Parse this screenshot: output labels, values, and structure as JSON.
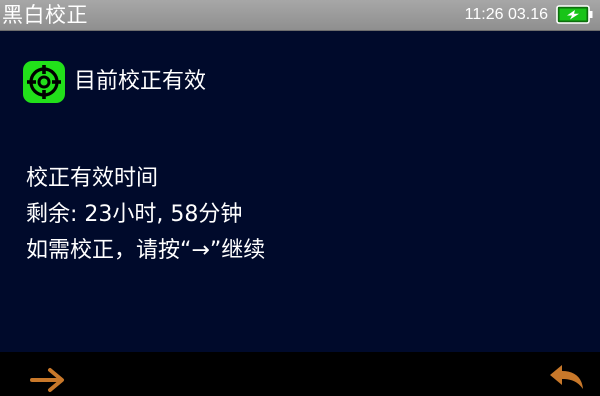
{
  "header": {
    "title": "黑白校正",
    "clock": "11:26 03.16"
  },
  "status": {
    "icon": "crosshair-target-icon",
    "text": "目前校正有效"
  },
  "info": {
    "heading": "校正有效时间",
    "remaining": "剩余: 23小时, 58分钟",
    "instruction": "如需校正，请按“→”继续"
  },
  "footer": {
    "next_icon": "arrow-right-icon",
    "back_icon": "return-arrow-icon"
  },
  "colors": {
    "background": "#000a2b",
    "titlebar": "#9a9a9a",
    "status_green": "#22e01a",
    "arrow_orange": "#c8782a",
    "battery_green": "#18c418"
  }
}
